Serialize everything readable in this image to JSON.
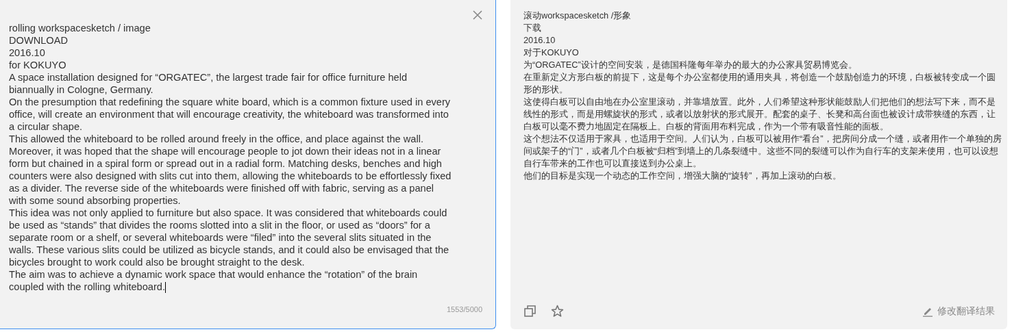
{
  "source": {
    "paragraphs": [
      "rolling workspacesketch / image",
      "DOWNLOAD",
      "2016.10",
      "for KOKUYO",
      "A space installation designed for  “ORGATEC”, the largest trade fair for office furniture held biannually in Cologne, Germany.",
      "On the presumption that redefining the square white board, which is a common fixture used in every office, will create an environment that will encourage creativity, the whiteboard was transformed into a circular shape.",
      "This allowed the whiteboard to be rolled around freely in the office, and place against the wall. Moreover, it was hoped that the shape will encourage people to jot down their ideas not in a linear form but chained in a spiral form or spread out in a radial form. Matching desks, benches and high counters were also designed with slits cut into them, allowing the whiteboards to be effortlessly fixed as a divider. The reverse side of the whiteboards were finished off with fabric, serving as a panel with some sound absorbing properties.",
      "This idea was not only applied to furniture but also space. It was considered that whiteboards could be used as  “stands”  that divides the rooms slotted into a slit in the floor, or used as  “doors”  for a separate room or a shelf, or several whiteboards were  “filed”  into the several slits situated in the walls. These various slits could be utilized as bicycle stands, and it could also be envisaged that the bicycles brought to work could also be brought straight to the desk.",
      "The aim was to achieve a dynamic work space that would enhance the  “rotation”  of the brain coupled with the rolling whiteboard."
    ],
    "focused": true,
    "char_count": "1553/5000"
  },
  "translation": {
    "paragraphs": [
      "滚动workspacesketch /形象",
      "下载",
      "2016.10",
      "对于KOKUYO",
      "为“ORGATEC”设计的空间安装，是德国科隆每年举办的最大的办公家具贸易博览会。",
      "在重新定义方形白板的前提下，这是每个办公室都使用的通用夹具，将创造一个鼓励创造力的环境，白板被转变成一个圆形的形状。",
      "这使得白板可以自由地在办公室里滚动，并靠墙放置。此外，人们希望这种形状能鼓励人们把他们的想法写下来，而不是线性的形式，而是用螺旋状的形式，或者以放射状的形式展开。配套的桌子、长凳和高台面也被设计成带狭缝的东西，让白板可以毫不费力地固定在隔板上。白板的背面用布料完成，作为一个带有吸音性能的面板。",
      "这个想法不仅适用于家具，也适用于空间。人们认为，白板可以被用作“看台”，把房间分成一个缝，或者用作一个单独的房间或架子的“门”，或者几个白板被“归档”到墙上的几条裂缝中。这些不同的裂缝可以作为自行车的支架来使用，也可以设想自行车带来的工作也可以直接送到办公桌上。",
      "他们的目标是实现一个动态的工作空间，增强大脑的“旋转”，再加上滚动的白板。"
    ],
    "edit_label": "修改翻译结果"
  }
}
